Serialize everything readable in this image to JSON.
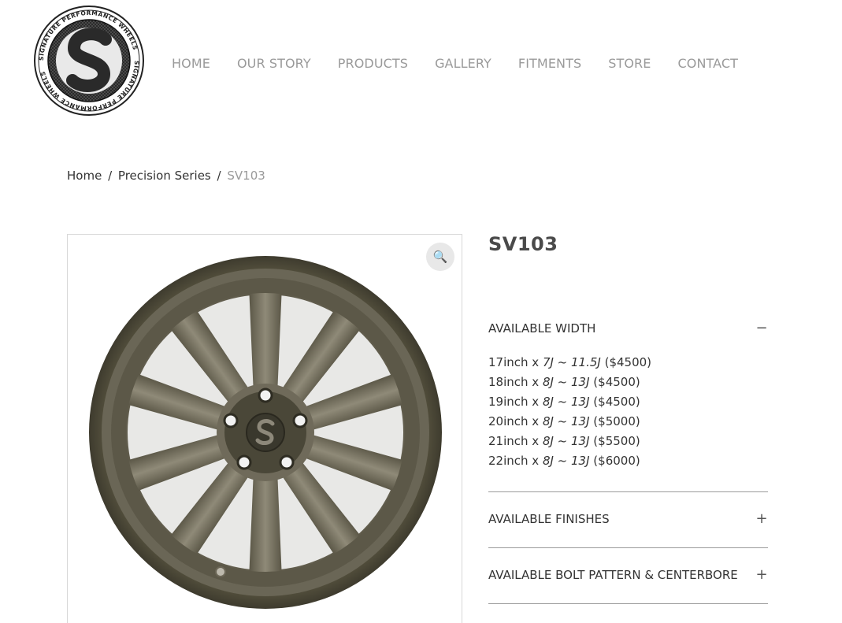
{
  "logo": {
    "ring_text": "SIGNATURE PERFORMANCE WHEELS",
    "letter": "S"
  },
  "nav": {
    "items": [
      "HOME",
      "OUR STORY",
      "PRODUCTS",
      "GALLERY",
      "FITMENTS",
      "STORE",
      "CONTACT"
    ]
  },
  "breadcrumb": {
    "home": "Home",
    "category": "Precision Series",
    "current": "SV103",
    "separator": "/"
  },
  "product": {
    "title": "SV103",
    "zoom_icon": "magnifier-icon",
    "wheel_center_letter": "S"
  },
  "accordion": {
    "width": {
      "label": "AVAILABLE WIDTH",
      "toggle": "−",
      "rows": [
        {
          "size": "17inch x ",
          "range": "7J ~ 11.5J",
          "price": " ($4500)"
        },
        {
          "size": "18inch x ",
          "range": "8J ~ 13J",
          "price": " ($4500)"
        },
        {
          "size": "19inch x ",
          "range": "8J ~ 13J",
          "price": " ($4500)"
        },
        {
          "size": "20inch x ",
          "range": "8J ~ 13J",
          "price": " ($5000)"
        },
        {
          "size": "21inch x ",
          "range": "8J ~ 13J",
          "price": " ($5500)"
        },
        {
          "size": "22inch x ",
          "range": "8J ~ 13J",
          "price": " ($6000)"
        }
      ]
    },
    "finishes": {
      "label": "AVAILABLE FINISHES",
      "toggle": "+"
    },
    "bolt": {
      "label": "AVAILABLE BOLT PATTERN & CENTERBORE",
      "toggle": "+"
    }
  },
  "colors": {
    "nav_text": "#9a9a9a",
    "body_text": "#333333",
    "divider": "#9a9a9a",
    "wheel_bronze": "#6b6656"
  }
}
